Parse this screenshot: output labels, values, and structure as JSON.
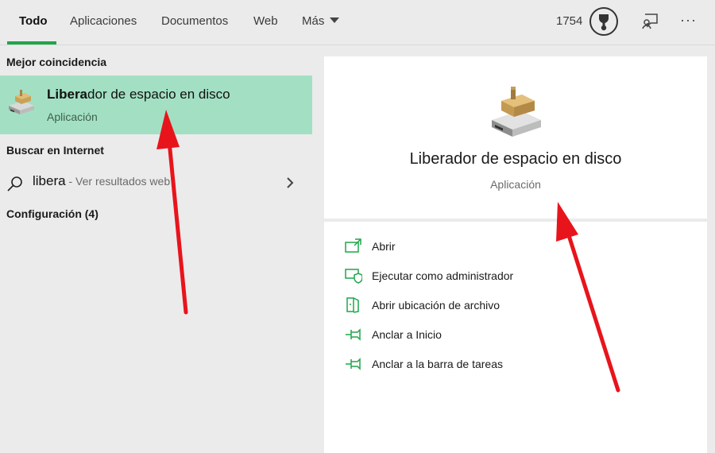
{
  "tabs": [
    {
      "label": "Todo"
    },
    {
      "label": "Aplicaciones"
    },
    {
      "label": "Documentos"
    },
    {
      "label": "Web"
    },
    {
      "label": "Más"
    }
  ],
  "header": {
    "points": "1754",
    "icons": {
      "medal": "medal-icon",
      "feedback": "feedback-icon",
      "more": "more-options-icon"
    },
    "more_glyph": "···"
  },
  "left_panel": {
    "best_match_heading": "Mejor coincidencia",
    "best_match": {
      "title_bold": "Libera",
      "title_rest": "dor de espacio en disco",
      "subtitle": "Aplicación",
      "icon": "disk-cleanup-icon"
    },
    "internet_heading": "Buscar en Internet",
    "web_result": {
      "query": "libera",
      "hint": " - Ver resultados web",
      "icon": "search-icon"
    },
    "settings_heading": "Configuración (4)"
  },
  "detail": {
    "title": "Liberador de espacio en disco",
    "subtitle": "Aplicación",
    "actions": [
      {
        "label": "Abrir",
        "icon": "open-icon"
      },
      {
        "label": "Ejecutar como administrador",
        "icon": "run-as-admin-icon"
      },
      {
        "label": "Abrir ubicación de archivo",
        "icon": "file-location-icon"
      },
      {
        "label": "Anclar a Inicio",
        "icon": "pin-icon"
      },
      {
        "label": "Anclar a la barra de tareas",
        "icon": "pin-icon"
      }
    ]
  },
  "colors": {
    "accent": "#1fa64a",
    "best_match_bg": "#a3e0c3",
    "action_icon": "#1fa64a",
    "annotation_arrow": "#e8141c"
  }
}
